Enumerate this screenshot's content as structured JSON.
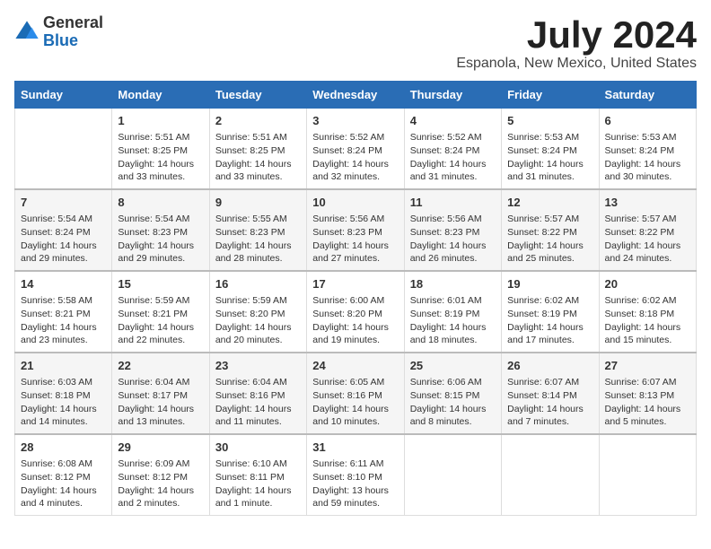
{
  "logo": {
    "general": "General",
    "blue": "Blue"
  },
  "title": "July 2024",
  "subtitle": "Espanola, New Mexico, United States",
  "days_header": [
    "Sunday",
    "Monday",
    "Tuesday",
    "Wednesday",
    "Thursday",
    "Friday",
    "Saturday"
  ],
  "weeks": [
    [
      {
        "day": "",
        "info": ""
      },
      {
        "day": "1",
        "info": "Sunrise: 5:51 AM\nSunset: 8:25 PM\nDaylight: 14 hours\nand 33 minutes."
      },
      {
        "day": "2",
        "info": "Sunrise: 5:51 AM\nSunset: 8:25 PM\nDaylight: 14 hours\nand 33 minutes."
      },
      {
        "day": "3",
        "info": "Sunrise: 5:52 AM\nSunset: 8:24 PM\nDaylight: 14 hours\nand 32 minutes."
      },
      {
        "day": "4",
        "info": "Sunrise: 5:52 AM\nSunset: 8:24 PM\nDaylight: 14 hours\nand 31 minutes."
      },
      {
        "day": "5",
        "info": "Sunrise: 5:53 AM\nSunset: 8:24 PM\nDaylight: 14 hours\nand 31 minutes."
      },
      {
        "day": "6",
        "info": "Sunrise: 5:53 AM\nSunset: 8:24 PM\nDaylight: 14 hours\nand 30 minutes."
      }
    ],
    [
      {
        "day": "7",
        "info": "Sunrise: 5:54 AM\nSunset: 8:24 PM\nDaylight: 14 hours\nand 29 minutes."
      },
      {
        "day": "8",
        "info": "Sunrise: 5:54 AM\nSunset: 8:23 PM\nDaylight: 14 hours\nand 29 minutes."
      },
      {
        "day": "9",
        "info": "Sunrise: 5:55 AM\nSunset: 8:23 PM\nDaylight: 14 hours\nand 28 minutes."
      },
      {
        "day": "10",
        "info": "Sunrise: 5:56 AM\nSunset: 8:23 PM\nDaylight: 14 hours\nand 27 minutes."
      },
      {
        "day": "11",
        "info": "Sunrise: 5:56 AM\nSunset: 8:23 PM\nDaylight: 14 hours\nand 26 minutes."
      },
      {
        "day": "12",
        "info": "Sunrise: 5:57 AM\nSunset: 8:22 PM\nDaylight: 14 hours\nand 25 minutes."
      },
      {
        "day": "13",
        "info": "Sunrise: 5:57 AM\nSunset: 8:22 PM\nDaylight: 14 hours\nand 24 minutes."
      }
    ],
    [
      {
        "day": "14",
        "info": "Sunrise: 5:58 AM\nSunset: 8:21 PM\nDaylight: 14 hours\nand 23 minutes."
      },
      {
        "day": "15",
        "info": "Sunrise: 5:59 AM\nSunset: 8:21 PM\nDaylight: 14 hours\nand 22 minutes."
      },
      {
        "day": "16",
        "info": "Sunrise: 5:59 AM\nSunset: 8:20 PM\nDaylight: 14 hours\nand 20 minutes."
      },
      {
        "day": "17",
        "info": "Sunrise: 6:00 AM\nSunset: 8:20 PM\nDaylight: 14 hours\nand 19 minutes."
      },
      {
        "day": "18",
        "info": "Sunrise: 6:01 AM\nSunset: 8:19 PM\nDaylight: 14 hours\nand 18 minutes."
      },
      {
        "day": "19",
        "info": "Sunrise: 6:02 AM\nSunset: 8:19 PM\nDaylight: 14 hours\nand 17 minutes."
      },
      {
        "day": "20",
        "info": "Sunrise: 6:02 AM\nSunset: 8:18 PM\nDaylight: 14 hours\nand 15 minutes."
      }
    ],
    [
      {
        "day": "21",
        "info": "Sunrise: 6:03 AM\nSunset: 8:18 PM\nDaylight: 14 hours\nand 14 minutes."
      },
      {
        "day": "22",
        "info": "Sunrise: 6:04 AM\nSunset: 8:17 PM\nDaylight: 14 hours\nand 13 minutes."
      },
      {
        "day": "23",
        "info": "Sunrise: 6:04 AM\nSunset: 8:16 PM\nDaylight: 14 hours\nand 11 minutes."
      },
      {
        "day": "24",
        "info": "Sunrise: 6:05 AM\nSunset: 8:16 PM\nDaylight: 14 hours\nand 10 minutes."
      },
      {
        "day": "25",
        "info": "Sunrise: 6:06 AM\nSunset: 8:15 PM\nDaylight: 14 hours\nand 8 minutes."
      },
      {
        "day": "26",
        "info": "Sunrise: 6:07 AM\nSunset: 8:14 PM\nDaylight: 14 hours\nand 7 minutes."
      },
      {
        "day": "27",
        "info": "Sunrise: 6:07 AM\nSunset: 8:13 PM\nDaylight: 14 hours\nand 5 minutes."
      }
    ],
    [
      {
        "day": "28",
        "info": "Sunrise: 6:08 AM\nSunset: 8:12 PM\nDaylight: 14 hours\nand 4 minutes."
      },
      {
        "day": "29",
        "info": "Sunrise: 6:09 AM\nSunset: 8:12 PM\nDaylight: 14 hours\nand 2 minutes."
      },
      {
        "day": "30",
        "info": "Sunrise: 6:10 AM\nSunset: 8:11 PM\nDaylight: 14 hours\nand 1 minute."
      },
      {
        "day": "31",
        "info": "Sunrise: 6:11 AM\nSunset: 8:10 PM\nDaylight: 13 hours\nand 59 minutes."
      },
      {
        "day": "",
        "info": ""
      },
      {
        "day": "",
        "info": ""
      },
      {
        "day": "",
        "info": ""
      }
    ]
  ]
}
